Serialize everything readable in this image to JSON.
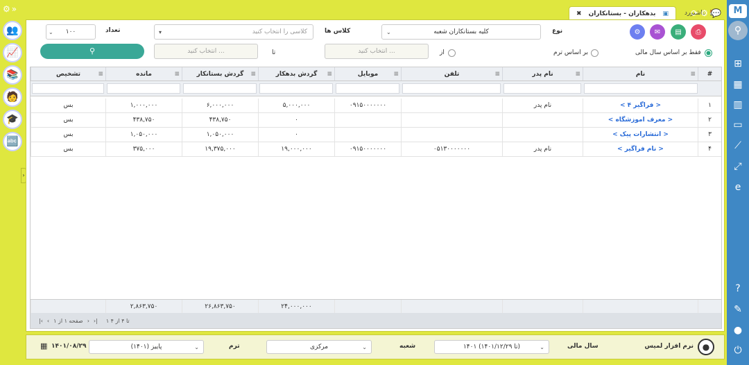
{
  "window": {
    "tab_active": "بدهکاران - بستانکاران",
    "tab_home": "داشبورد"
  },
  "filters": {
    "type_label": "نوع",
    "type_value": "کلیه بستانکاران شعبه",
    "classes_label": "کلاس ها",
    "classes_placeholder": "کلاسی را انتخاب کنید",
    "count_label": "تعداد",
    "count_value": "۱۰۰",
    "from_label": "از",
    "from_placeholder": "انتخاب کنید ...",
    "to_label": "تا",
    "to_placeholder": "انتخاب کنید ...",
    "radio_fiscal": "فقط بر اساس سال مالی",
    "radio_term": "بر اساس ترم"
  },
  "table": {
    "headers": [
      "#",
      "نام",
      "نام پدر",
      "تلفن",
      "موبایل",
      "گردش بدهکار",
      "گردش بستانکار",
      "مانده",
      "تشخیص"
    ],
    "rows": [
      [
        "۱",
        "< فراگیر ۴ >",
        "نام پدر",
        "",
        "۰۹۱۵۰۰۰۰۰۰۰",
        "۵,۰۰۰,۰۰۰",
        "۶,۰۰۰,۰۰۰",
        "۱,۰۰۰,۰۰۰",
        "بس"
      ],
      [
        "۲",
        "< معرف اموزشگاه >",
        "",
        "",
        "",
        "۰",
        "۴۳۸,۷۵۰",
        "۴۳۸,۷۵۰",
        "بس"
      ],
      [
        "۳",
        "< انتشارات پیک >",
        "",
        "",
        "",
        "۰",
        "۱,۰۵۰,۰۰۰",
        "۱,۰۵۰,۰۰۰",
        "بس"
      ],
      [
        "۴",
        "< نام فراگیر >",
        "نام پدر",
        "۰۵۱۳۰۰۰۰۰۰۰",
        "۰۹۱۵۰۰۰۰۰۰۰",
        "۱۹,۰۰۰,۰۰۰",
        "۱۹,۳۷۵,۰۰۰",
        "۳۷۵,۰۰۰",
        "بس"
      ]
    ],
    "totals": {
      "debit": "۲۴,۰۰۰,۰۰۰",
      "credit": "۲۶,۸۶۳,۷۵۰",
      "balance": "۲,۸۶۳,۷۵۰"
    },
    "pager": {
      "page_text": "صفحه ۱ از ۱",
      "range_text": "۱ تا ۴ از ۴"
    }
  },
  "footer": {
    "software_name": "نرم افزار لمیس",
    "fiscal_label": "سال مالی",
    "fiscal_value": "۱۴۰۱ (تا ۱۴۰۱/۱۲/۲۹)",
    "branch_label": "شعبه",
    "branch_value": "مرکزی",
    "term_label": "ترم",
    "term_value": "پاییز (۱۴۰۱)",
    "date": "۱۴۰۱/۰۸/۲۹"
  },
  "colors": {
    "accent_yellow": "#dfe73f",
    "sidebar_blue": "#3f88c5",
    "search_teal": "#3aa897",
    "link_blue": "#2b6cd8"
  }
}
